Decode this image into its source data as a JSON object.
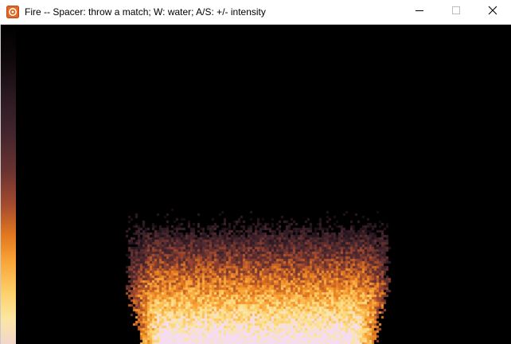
{
  "window": {
    "title": "Fire -- Spacer: throw a match; W: water; A/S: +/- intensity",
    "app_icon": "fire-app-icon",
    "controls": {
      "minimize_icon": "minimize-icon",
      "maximize_icon": "maximize-icon",
      "close_icon": "close-icon"
    }
  },
  "canvas": {
    "background": "#000000",
    "palette_colors": [
      "#000000",
      "#2a1821",
      "#43252e",
      "#6a3330",
      "#a2492f",
      "#e2781f",
      "#f9a437",
      "#fdd06a",
      "#fbe7a1",
      "#f5dcf4"
    ]
  }
}
